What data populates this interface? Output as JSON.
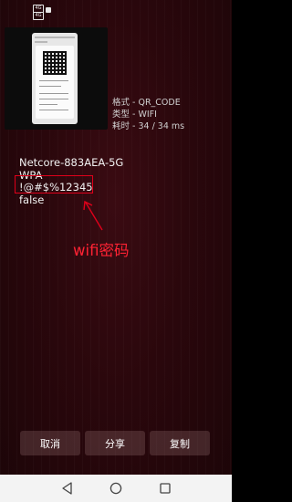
{
  "status_bar": {
    "sim1_label": "4G",
    "sim2_label": "4G"
  },
  "thumbnail": {
    "header_text": "WLAN",
    "network_text": "Netcore-883AEA-5G"
  },
  "scan_info": {
    "format": "格式 - QR_CODE",
    "type": "类型 - WIFI",
    "time": "耗时 - 34 / 34 ms"
  },
  "wifi_result": {
    "ssid": "Netcore-883AEA-5G",
    "security": "WPA",
    "password": "!@#$%12345",
    "hidden": "false"
  },
  "annotation": {
    "label": "wifi密码",
    "color": "#ff2233"
  },
  "actions": {
    "cancel_label": "取消",
    "share_label": "分享",
    "copy_label": "复制"
  },
  "nav_bar": {
    "back_icon": "triangle-back-icon",
    "home_icon": "circle-home-icon",
    "recent_icon": "square-recent-icon"
  }
}
